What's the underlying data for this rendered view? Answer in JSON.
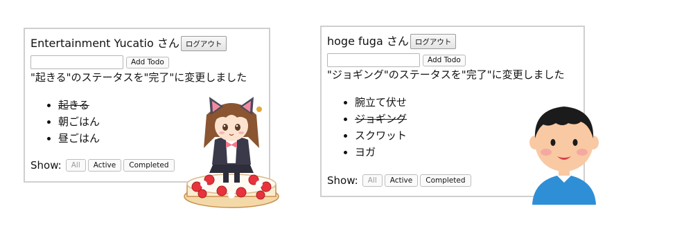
{
  "left_app": {
    "greeting": "Entertainment Yucatio さん",
    "logout_label": "ログアウト",
    "input_value": "",
    "add_label": "Add Todo",
    "status_message": "\"起きる\"のステータスを\"完了\"に変更しました",
    "todos": [
      {
        "text": "起きる",
        "completed": true
      },
      {
        "text": "朝ごはん",
        "completed": false
      },
      {
        "text": "昼ごはん",
        "completed": false
      }
    ],
    "show_label": "Show:",
    "filters": [
      "All",
      "Active",
      "Completed"
    ],
    "active_filter": "All"
  },
  "right_app": {
    "greeting": "hoge fuga さん",
    "logout_label": "ログアウト",
    "input_value": "",
    "add_label": "Add Todo",
    "status_message": "\"ジョギング\"のステータスを\"完了\"に変更しました",
    "todos": [
      {
        "text": "腕立て伏せ",
        "completed": false
      },
      {
        "text": "ジョギング",
        "completed": true
      },
      {
        "text": "スクワット",
        "completed": false
      },
      {
        "text": "ヨガ",
        "completed": false
      }
    ],
    "show_label": "Show:",
    "filters": [
      "All",
      "Active",
      "Completed"
    ],
    "active_filter": "All"
  },
  "illustrations": {
    "left": "cat-girl-on-cake-illustration",
    "right": "smiling-boy-illustration"
  },
  "colors": {
    "panel_border": "#cfcfcf",
    "disabled_text": "#9a9a9a"
  }
}
